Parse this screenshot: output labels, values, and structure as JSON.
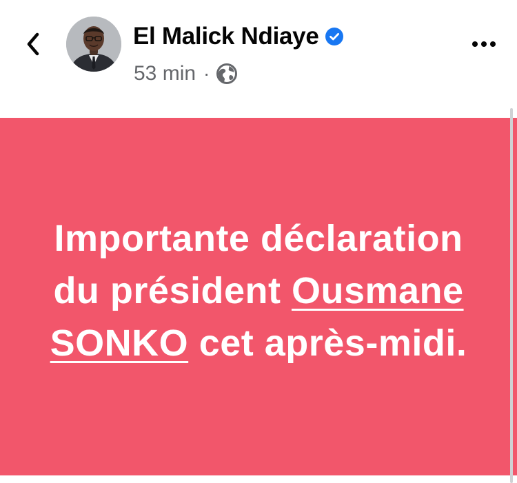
{
  "post": {
    "author": {
      "name": "El Malick Ndiaye",
      "verified": true,
      "avatar_icon": "person-avatar"
    },
    "meta": {
      "time": "53 min",
      "separator": "·",
      "audience_icon": "globe-icon"
    },
    "header": {
      "back_icon": "chevron-left-icon",
      "more_icon": "more-horizontal-icon"
    },
    "content": {
      "text_before": "Importante déclaration du président ",
      "mention": "Ousmane SONKO",
      "text_after": " cet après-midi.",
      "background_color": "#f2566b",
      "text_color": "#ffffff"
    }
  },
  "colors": {
    "verified_blue": "#1877f2",
    "secondary_text": "#65676b",
    "primary_text": "#050505"
  }
}
